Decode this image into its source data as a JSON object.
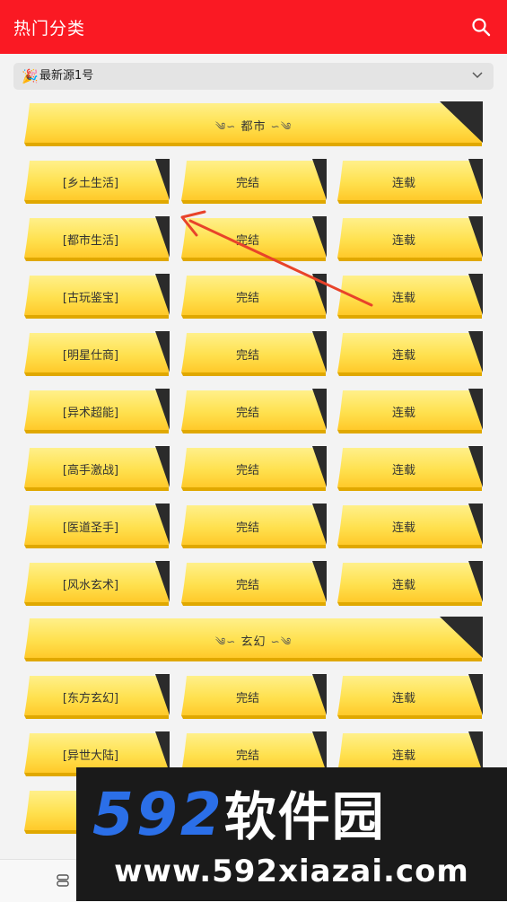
{
  "appbar": {
    "title": "热门分类",
    "search_icon": "search-icon"
  },
  "source": {
    "icon": "party-popper-icon",
    "icon_glyph": "🎉",
    "label": "最新源1号",
    "dropdown_icon": "chevron-down-icon"
  },
  "sections": [
    {
      "name": "都市",
      "rows": [
        [
          "[乡土生活]",
          "完结",
          "连载"
        ],
        [
          "[都市生活]",
          "完结",
          "连载"
        ],
        [
          "[古玩鉴宝]",
          "完结",
          "连载"
        ],
        [
          "[明星仕商]",
          "完结",
          "连载"
        ],
        [
          "[异术超能]",
          "完结",
          "连载"
        ],
        [
          "[高手激战]",
          "完结",
          "连载"
        ],
        [
          "[医道圣手]",
          "完结",
          "连载"
        ],
        [
          "[风水玄术]",
          "完结",
          "连载"
        ]
      ]
    },
    {
      "name": "玄幻",
      "rows": [
        [
          "[东方玄幻]",
          "完结",
          "连载"
        ],
        [
          "[异世大陆]",
          "完结",
          "连载"
        ],
        [
          "[",
          "",
          ""
        ]
      ]
    }
  ],
  "ornaments": {
    "left": "༄∽",
    "right": "∽༄"
  },
  "bottombar": {
    "icon": "stack-icon"
  },
  "watermark": {
    "brand_digits": "592",
    "brand_text": "软件园",
    "url": "www.592xiazai.com"
  },
  "colors": {
    "appbar": "#fa1923",
    "tile_yellow": "#ffe15a",
    "tile_dark": "#2b2b2b",
    "arrow": "#e8432a"
  }
}
